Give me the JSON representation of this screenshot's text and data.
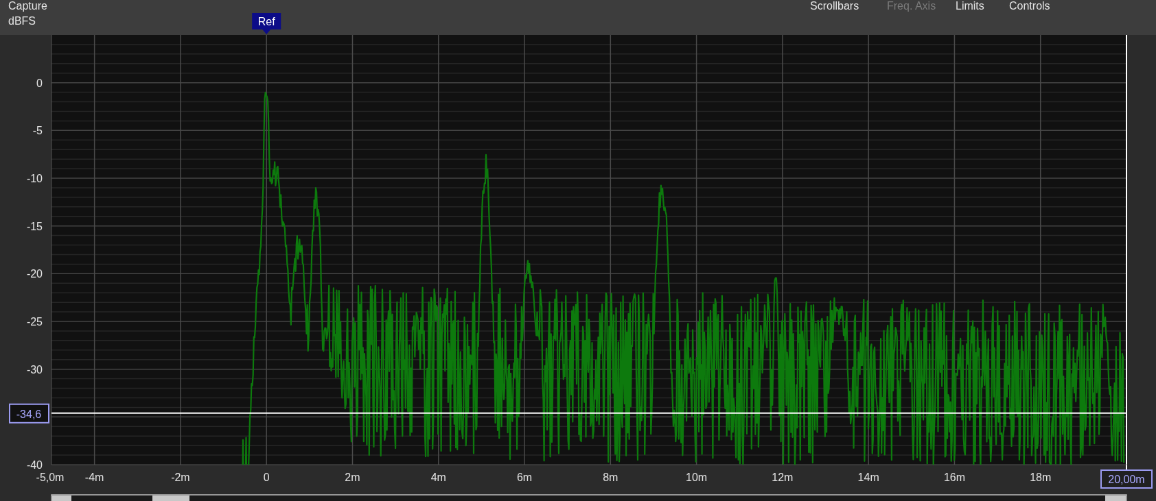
{
  "header": {
    "title": "Capture",
    "menu": [
      {
        "label": "Scrollbars",
        "disabled": false
      },
      {
        "label": "Freq. Axis",
        "disabled": true
      },
      {
        "label": "Limits",
        "disabled": false
      },
      {
        "label": "Controls",
        "disabled": false
      }
    ]
  },
  "chart": {
    "y_unit": "dBFS",
    "marker": "Ref",
    "cursor_value": "-34,6",
    "x_end": "20,00m",
    "y_ticks": [
      "0",
      "-5",
      "-10",
      "-15",
      "-20",
      "-25",
      "-30",
      "-40"
    ],
    "x_ticks": [
      "-5,0m",
      "-4m",
      "-2m",
      "0",
      "2m",
      "4m",
      "6m",
      "8m",
      "10m",
      "12m",
      "14m",
      "16m",
      "18m"
    ]
  }
}
